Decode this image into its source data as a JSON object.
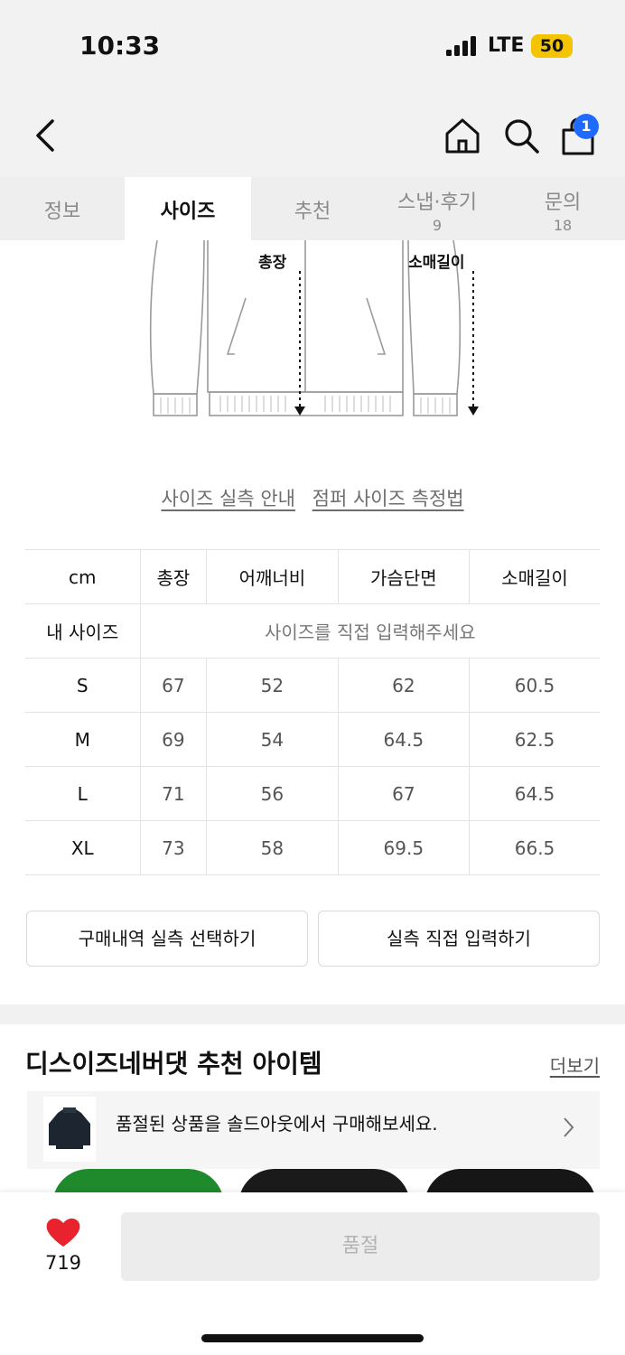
{
  "status": {
    "time": "10:33",
    "network": "LTE",
    "battery": "50"
  },
  "nav": {
    "cart_count": "1"
  },
  "tabs": [
    {
      "label": "정보",
      "count": ""
    },
    {
      "label": "사이즈",
      "count": ""
    },
    {
      "label": "추천",
      "count": ""
    },
    {
      "label": "스냅·후기",
      "count": "9"
    },
    {
      "label": "문의",
      "count": "18"
    }
  ],
  "illustration": {
    "label_total": "총장",
    "label_sleeve": "소매길이"
  },
  "links": {
    "actual_size_guide": "사이즈 실측 안내",
    "measure_method": "점퍼 사이즈 측정법"
  },
  "size_table": {
    "headers": [
      "cm",
      "총장",
      "어깨너비",
      "가슴단면",
      "소매길이"
    ],
    "my_size_label": "내 사이즈",
    "my_size_placeholder": "사이즈를 직접 입력해주세요",
    "rows": [
      {
        "size": "S",
        "values": [
          "67",
          "52",
          "62",
          "60.5"
        ]
      },
      {
        "size": "M",
        "values": [
          "69",
          "54",
          "64.5",
          "62.5"
        ]
      },
      {
        "size": "L",
        "values": [
          "71",
          "56",
          "67",
          "64.5"
        ]
      },
      {
        "size": "XL",
        "values": [
          "73",
          "58",
          "69.5",
          "66.5"
        ]
      }
    ]
  },
  "buttons": {
    "select_purchase": "구매내역 실측 선택하기",
    "manual_input": "실측 직접 입력하기"
  },
  "recommend": {
    "title": "디스이즈네버댓 추천 아이템",
    "more": "더보기",
    "banner_text": "품절된 상품을 솔드아웃에서 구매해보세요."
  },
  "bottom": {
    "likes": "719",
    "soldout_label": "품절"
  },
  "colors": {
    "accent_blue": "#1f6bff",
    "heart_red": "#e8232d",
    "battery_yellow": "#f4c400"
  }
}
